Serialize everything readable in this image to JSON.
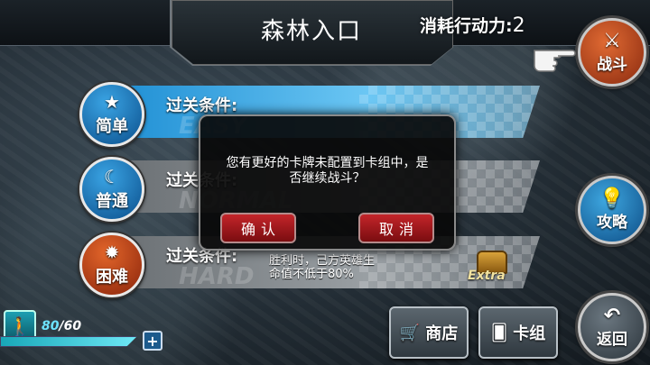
{
  "header": {
    "title": "森林入口",
    "cost_label": "消耗行动力:",
    "cost_value": "2"
  },
  "side_buttons": {
    "fight": "战斗",
    "guide": "攻略",
    "back": "返回"
  },
  "difficulties": [
    {
      "badge": "简单",
      "watermark": "EASY",
      "condition_label": "过关条件:",
      "condition_text": ""
    },
    {
      "badge": "普通",
      "watermark": "NORMAL",
      "condition_label": "过关条件:",
      "condition_text": ""
    },
    {
      "badge": "困难",
      "watermark": "HARD",
      "condition_label": "过关条件:",
      "condition_line1": "胜利时，己方英雄生",
      "condition_line2": "命值不低于80%",
      "reward": "Extra"
    }
  ],
  "dialog": {
    "line1": "您有更好的卡牌未配置到卡组中，是",
    "line2": "否继续战斗？",
    "confirm": "确认",
    "cancel": "取消"
  },
  "stamina": {
    "current": "80",
    "max": "/60",
    "fill": 1.0
  },
  "bottom": {
    "shop": "商店",
    "deck": "卡组"
  },
  "icons": {
    "fight": "crossed-swords-icon",
    "guide": "lightbulb-icon",
    "back": "return-arrow-icon",
    "easy": "star-icon",
    "normal": "moon-icon",
    "hard": "sun-icon",
    "shop": "cart-icon",
    "deck": "cards-icon",
    "stamina": "walking-man-icon"
  },
  "colors": {
    "accent_blue": "#1f8fd4",
    "accent_red": "#c4252a",
    "accent_orange": "#e06a33"
  }
}
